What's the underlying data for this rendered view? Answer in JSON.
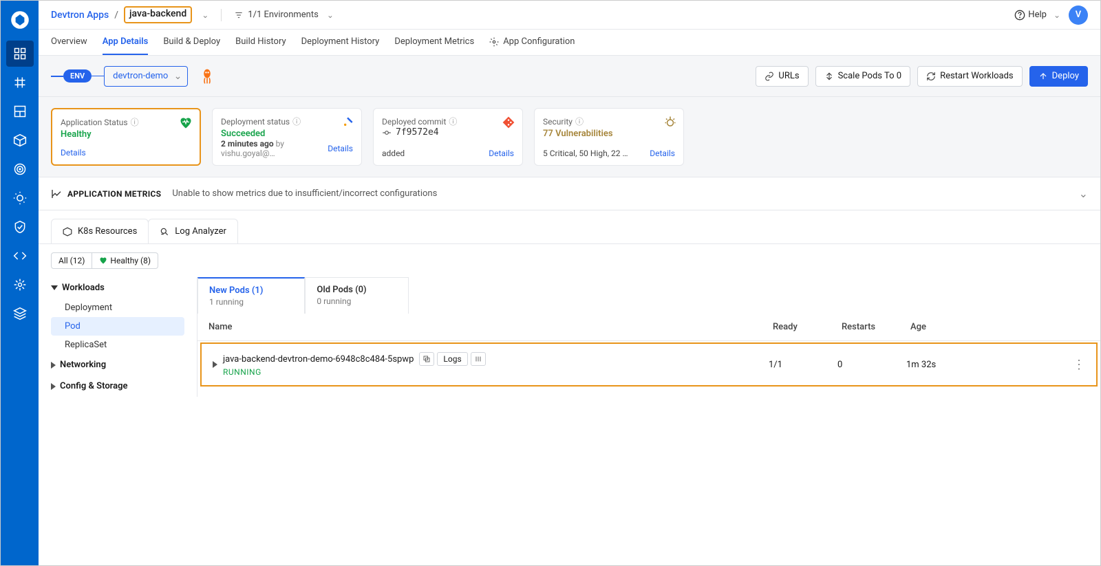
{
  "header": {
    "breadcrumb_parent": "Devtron Apps",
    "breadcrumb_current": "java-backend",
    "env_chip": "1/1 Environments",
    "help": "Help",
    "avatar": "V"
  },
  "tabs": [
    "Overview",
    "App Details",
    "Build & Deploy",
    "Build History",
    "Deployment History",
    "Deployment Metrics",
    "App Configuration"
  ],
  "envRow": {
    "pill": "ENV",
    "selected": "devtron-demo",
    "urls": "URLs",
    "scale": "Scale Pods To 0",
    "restart": "Restart Workloads",
    "deploy": "Deploy"
  },
  "cards": [
    {
      "title": "Application Status",
      "value": "Healthy",
      "footer_left": "Details",
      "footer_right": ""
    },
    {
      "title": "Deployment status",
      "value": "Succeeded",
      "footer_left": "2 minutes ago",
      "footer_mid": "by vishu.goyal@…",
      "footer_right": "Details"
    },
    {
      "title": "Deployed commit",
      "value": "7f9572e4",
      "footer_left": "added",
      "footer_right": "Details"
    },
    {
      "title": "Security",
      "value": "77 Vulnerabilities",
      "footer_left": "5 Critical, 50 High, 22 …",
      "footer_right": "Details"
    }
  ],
  "metrics": {
    "label": "APPLICATION METRICS",
    "msg": "Unable to show metrics due to insufficient/incorrect configurations"
  },
  "subtabs": [
    "K8s Resources",
    "Log Analyzer"
  ],
  "statusChips": {
    "all": "All (12)",
    "healthy": "Healthy (8)"
  },
  "tree": {
    "groups": {
      "workloads": "Workloads",
      "networking": "Networking",
      "config": "Config & Storage"
    },
    "workloads_items": [
      "Deployment",
      "Pod",
      "ReplicaSet"
    ]
  },
  "podTabs": {
    "new": {
      "label": "New Pods (1)",
      "sub": "1 running"
    },
    "old": {
      "label": "Old Pods (0)",
      "sub": "0 running"
    }
  },
  "podHeader": {
    "name": "Name",
    "ready": "Ready",
    "restarts": "Restarts",
    "age": "Age"
  },
  "podRow": {
    "name": "java-backend-devtron-demo-6948c8c484-5spwp",
    "status": "RUNNING",
    "logs": "Logs",
    "ready": "1/1",
    "restarts": "0",
    "age": "1m 32s"
  }
}
